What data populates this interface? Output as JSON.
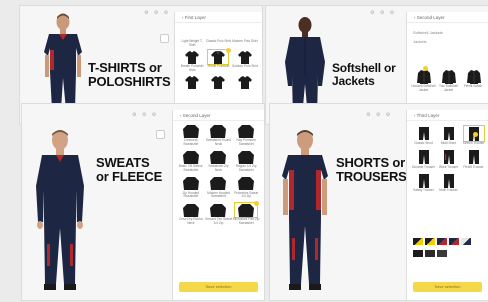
{
  "panels": {
    "tshirts": {
      "heading": [
        "T-SHIRTS or",
        "POLOSHIRTS"
      ],
      "toolbar": "⚙ ⚙ ⚙",
      "side_title": "‹  First Layer",
      "items": [
        "Light Weight T-Shirt",
        "Classic Polo Shirt",
        "Modern Polo Shirt",
        "Breath Poloshirt Hivis",
        "Flexfit Poloshirt",
        "Outdoor Polo Shirt",
        "",
        "",
        ""
      ]
    },
    "softshell": {
      "heading": [
        "Softshell or",
        "Jackets"
      ],
      "toolbar": "⚙ ⚙ ⚙",
      "side_title": "‹  Second Layer",
      "side_sub1": "Softshell Jackets",
      "side_sub2": "Jackets",
      "items": [
        "Hooded Softshell Jacket",
        "Two Softshell Jacket",
        "Flexfit Softsh.",
        "",
        "",
        ""
      ]
    },
    "sweats": {
      "heading": [
        "SWEATS",
        "or FLEECE"
      ],
      "toolbar": "⚙ ⚙ ⚙",
      "side_title": "‹  Second Layer",
      "items": [
        "Crewneck Sweatshirt",
        "Sweatshirt Round Neck",
        "Nay Premium Sweatshirt",
        "Basic 7/8 Sleeve Sweatshirt",
        "Sweatshirt Zip Neck",
        "Raglan 1/4 Zip Sweatshirt",
        "Zip Hooded Sweatshirt",
        "Modern Hooded Sweatshirt",
        "Protective Sweat 1/4 Zip",
        "Crew Dry Round Neck",
        "Second Tier Sweat 1/4 Zip",
        "Microshell Flex Zip Sweatshirt"
      ],
      "cta": "Save selection"
    },
    "shorts": {
      "heading": [
        "SHORTS or",
        "TROUSERS"
      ],
      "toolbar": "⚙ ⚙ ⚙",
      "side_title": "‹  Third Layer",
      "items": [
        "Classic Short",
        "Multi Short",
        "Stretch Trouser",
        "Durable Trouser",
        "Work Trouser",
        "Flexfit Trouser",
        "Safety Trouser",
        "Multi Trouser",
        ""
      ],
      "cta": "Save selection"
    }
  },
  "colors": {
    "navy": "#1d2642",
    "red": "#b0272e",
    "yellow": "#f5cf2e"
  },
  "swatches": [
    "#1c1c1c",
    "#f0d000",
    "#1d2642",
    "#b0272e",
    "#e8e8e8",
    "#222b4a"
  ]
}
